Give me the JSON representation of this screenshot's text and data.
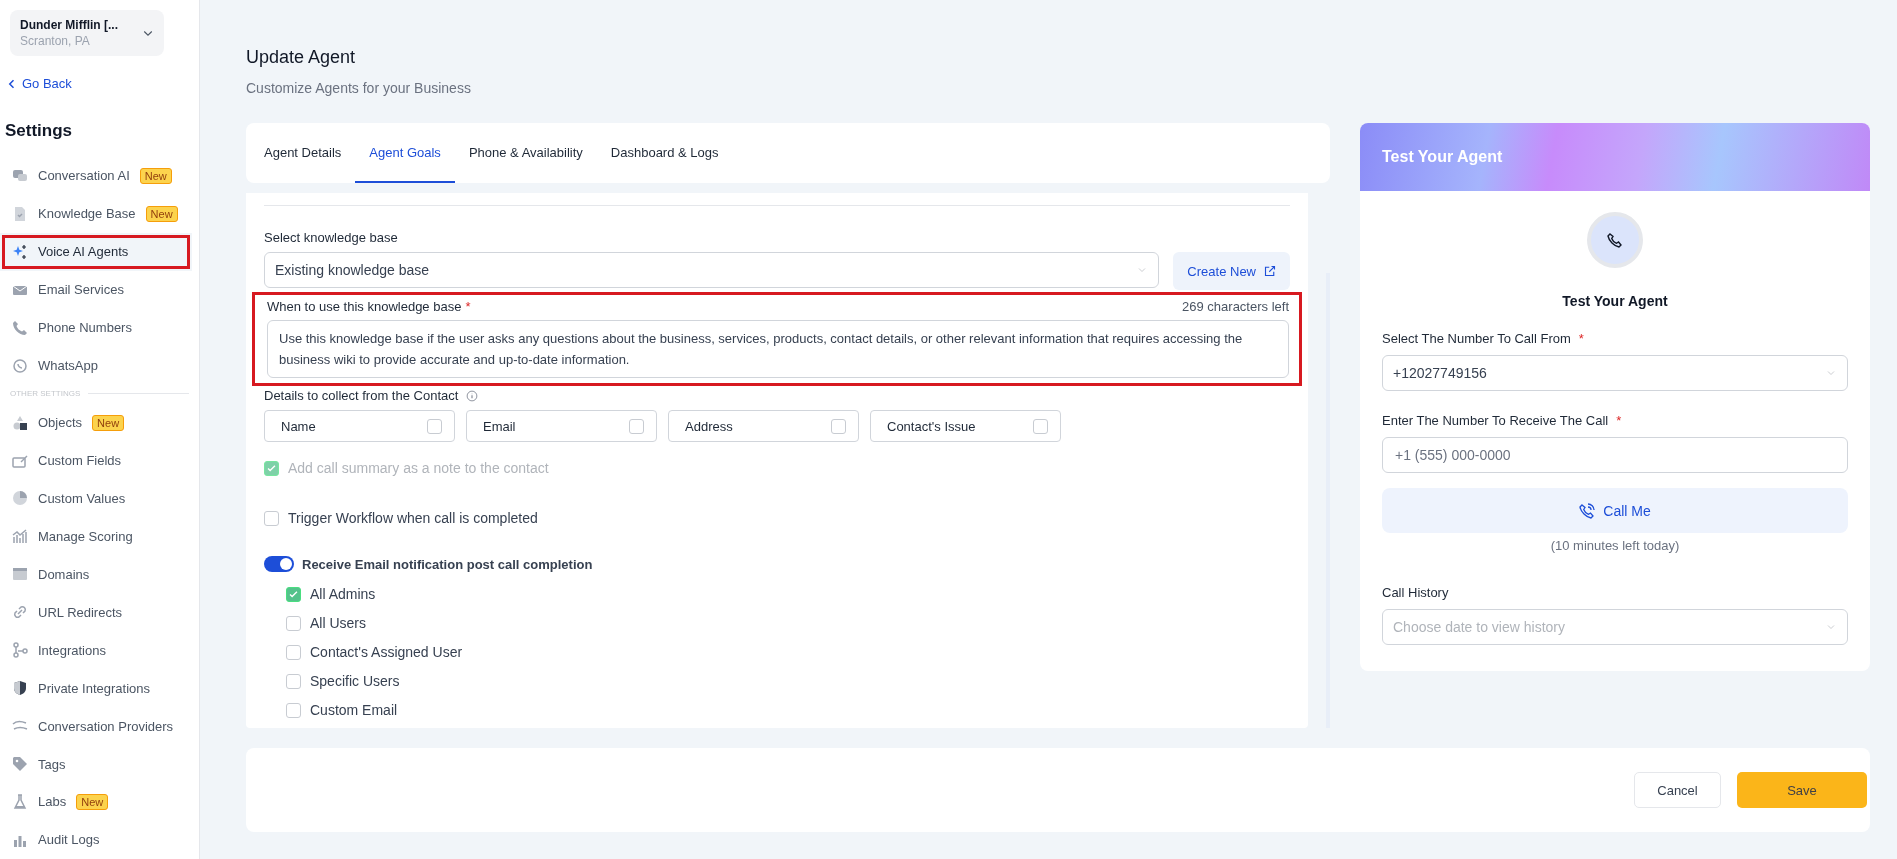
{
  "account": {
    "name": "Dunder Mifflin [...",
    "location": "Scranton, PA"
  },
  "back_link": "Go Back",
  "sidebar": {
    "title": "Settings",
    "sections": [
      {
        "items": [
          {
            "label": "Conversation AI",
            "badge": "New",
            "selected": false,
            "highlighted": false
          },
          {
            "label": "Knowledge Base",
            "badge": "New",
            "selected": false,
            "highlighted": false
          },
          {
            "label": "Voice AI Agents",
            "selected": true,
            "highlighted": true
          },
          {
            "label": "Email Services",
            "selected": false,
            "highlighted": false
          },
          {
            "label": "Phone Numbers",
            "selected": false,
            "highlighted": false
          },
          {
            "label": "WhatsApp",
            "selected": false,
            "highlighted": false
          }
        ]
      },
      {
        "heading": "OTHER SETTINGS",
        "items": [
          {
            "label": "Objects",
            "badge": "New",
            "selected": false,
            "highlighted": false
          },
          {
            "label": "Custom Fields",
            "selected": false,
            "highlighted": false
          },
          {
            "label": "Custom Values",
            "selected": false,
            "highlighted": false
          },
          {
            "label": "Manage Scoring",
            "selected": false,
            "highlighted": false
          },
          {
            "label": "Domains",
            "selected": false,
            "highlighted": false
          },
          {
            "label": "URL Redirects",
            "selected": false,
            "highlighted": false
          },
          {
            "label": "Integrations",
            "selected": false,
            "highlighted": false
          },
          {
            "label": "Private Integrations",
            "selected": false,
            "highlighted": false
          },
          {
            "label": "Conversation Providers",
            "selected": false,
            "highlighted": false
          },
          {
            "label": "Tags",
            "selected": false,
            "highlighted": false
          },
          {
            "label": "Labs",
            "badge": "New",
            "selected": false,
            "highlighted": false
          },
          {
            "label": "Audit Logs",
            "selected": false,
            "highlighted": false
          }
        ]
      }
    ]
  },
  "page": {
    "title": "Update Agent",
    "subtitle": "Customize Agents for your Business"
  },
  "tabs": [
    {
      "label": "Agent Details",
      "selected": false
    },
    {
      "label": "Agent Goals",
      "selected": true
    },
    {
      "label": "Phone & Availability",
      "selected": false
    },
    {
      "label": "Dashboard & Logs",
      "selected": false
    }
  ],
  "form": {
    "knowledge_base": {
      "label": "Select knowledge base",
      "value": "Existing knowledge base",
      "create_button": "Create New"
    },
    "usage": {
      "label": "When to use this knowledge base",
      "required_mark": "*",
      "counter": "269 characters left",
      "highlighted": true,
      "value": "Use this knowledge base if the user asks any questions about the business, services, products, contact details, or other relevant information that requires accessing the business wiki to provide accurate and up-to-date information."
    },
    "details": {
      "label": "Details to collect from the Contact",
      "options": [
        {
          "label": "Name",
          "checked": false
        },
        {
          "label": "Email",
          "checked": false
        },
        {
          "label": "Address",
          "checked": false
        },
        {
          "label": "Contact's Issue",
          "checked": false
        }
      ]
    },
    "options": [
      {
        "label": "Add call summary as a note to the contact",
        "checked": true,
        "disabled": true
      },
      {
        "label": "Trigger Workflow when call is completed",
        "checked": false,
        "disabled": false
      }
    ],
    "email_notification": {
      "label": "Receive Email notification post call completion",
      "on": true,
      "recipients": [
        {
          "label": "All Admins",
          "checked": true
        },
        {
          "label": "All Users",
          "checked": false
        },
        {
          "label": "Contact's Assigned User",
          "checked": false
        },
        {
          "label": "Specific Users",
          "checked": false
        },
        {
          "label": "Custom Email",
          "checked": false
        }
      ]
    }
  },
  "test_panel": {
    "header": "Test Your Agent",
    "title": "Test Your Agent",
    "from": {
      "label": "Select The Number To Call From",
      "required_mark": "*",
      "value": "+12027749156"
    },
    "to": {
      "label": "Enter The Number To Receive The Call",
      "required_mark": "*",
      "placeholder": "+1 (555) 000-0000"
    },
    "call_button": "Call Me",
    "minutes_left": "(10 minutes left today)",
    "history": {
      "label": "Call History",
      "placeholder": "Choose date to view history"
    }
  },
  "footer": {
    "buttons": [
      {
        "label": "Cancel",
        "kind": "secondary"
      },
      {
        "label": "Save",
        "kind": "primary"
      }
    ]
  }
}
